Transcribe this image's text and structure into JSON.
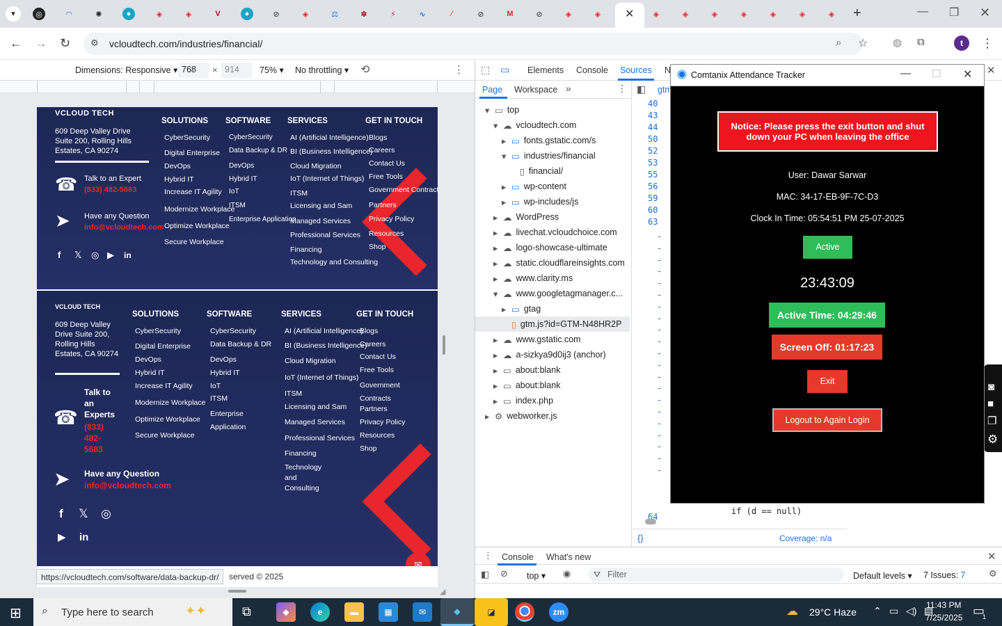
{
  "browser": {
    "url": "vcloudtech.com/industries/financial/",
    "status_url": "https://vcloudtech.com/software/data-backup-dr/",
    "profile_initial": "t"
  },
  "device_toolbar": {
    "dimensions_label": "Dimensions: Responsive",
    "width": "768",
    "x": "×",
    "height": "914",
    "zoom": "75%",
    "throttle": "No throttling"
  },
  "site": {
    "logo_text": "VCLOUD TECH",
    "address1": "609 Deep Valley Drive Suite 200, Rolling Hills Estates, CA 90274",
    "address2": "609 Deep Valley Drive Suite 200, Rolling Hills Estates, CA 90274",
    "talk_label": "Talk to an Expert",
    "talk_label2": "Talk to an Experts",
    "phone": "(833) 482-5683",
    "question_label": "Have any Question",
    "email": "info@vcloudtech.com",
    "copyright": "served © 2025",
    "col_heads": [
      "SOLUTIONS",
      "SOFTWARE",
      "SERVICES",
      "GET IN TOUCH"
    ],
    "solutions": [
      "CyberSecurity",
      "Digital Enterprise",
      "DevOps",
      "Hybrid IT",
      "Increase IT Agility",
      "Modernize Workplace",
      "Optimize Workplace",
      "Secure Workplace"
    ],
    "software": [
      "CyberSecurity",
      "Data Backup & DR",
      "DevOps",
      "Hybrid IT",
      "IoT",
      "ITSM",
      "Enterprise Application"
    ],
    "services": [
      "AI (Artificial Intelligence)",
      "BI (Business Intelligence)",
      "Cloud Migration",
      "IoT (Internet of Things)",
      "ITSM",
      "Licensing and Sam",
      "Managed Services",
      "Professional Services",
      "Financing",
      "Technology and Consulting"
    ],
    "touch": [
      "Blogs",
      "Careers",
      "Contact Us",
      "Free Tools",
      "Government Contracts",
      "Partners",
      "Privacy Policy",
      "Resources",
      "Shop"
    ]
  },
  "devtools": {
    "tabs": [
      "Elements",
      "Console",
      "Sources",
      "N"
    ],
    "subtabs": [
      "Page",
      "Workspace"
    ],
    "file_tab": "gtm",
    "tree": [
      "top",
      "vcloudtech.com",
      "fonts.gstatic.com/s",
      "industries/financial",
      "financial/",
      "wp-content",
      "wp-includes/js",
      "WordPress",
      "livechat.vcloudchoice.com",
      "logo-showcase-ultimate",
      "static.cloudflareinsights.com",
      "www.clarity.ms",
      "www.googletagmanager.c...",
      "gtag",
      "gtm.js?id=GTM-N48HR2P",
      "www.gstatic.com",
      "a-sizkya9d0ij3 (anchor)",
      "about:blank",
      "about:blank",
      "index.php",
      "webworker.js"
    ],
    "line_numbers": [
      "40",
      "43",
      "44",
      "50",
      "52",
      "53",
      "55",
      "56",
      "59",
      "60",
      "63",
      "64"
    ],
    "code_line": "if (d == null)",
    "coverage": "Coverage: n/a",
    "drawer_tabs": [
      "Console",
      "What's new"
    ],
    "console_context": "top",
    "filter_placeholder": "Filter",
    "levels": "Default levels",
    "issues_label": "7 Issues:",
    "issues_count": "7"
  },
  "tracker": {
    "title": "Comtanix Attendance Tracker",
    "notice": "Notice: Please press the exit button and shut down your PC when leaving the office",
    "user": "User: Dawar Sarwar",
    "mac": "MAC: 34-17-EB-9F-7C-D3",
    "clock_in": "Clock In Time: 05:54:51 PM 25-07-2025",
    "status": "Active",
    "clock": "23:43:09",
    "active_time": "Active Time: 04:29:46",
    "screen_off": "Screen Off: 01:17:23",
    "exit": "Exit",
    "logout": "Logout to Again Login"
  },
  "taskbar": {
    "search_placeholder": "Type here to search",
    "weather": "29°C  Haze",
    "time": "11:43 PM",
    "date": "7/25/2025",
    "notif_count": "1"
  }
}
